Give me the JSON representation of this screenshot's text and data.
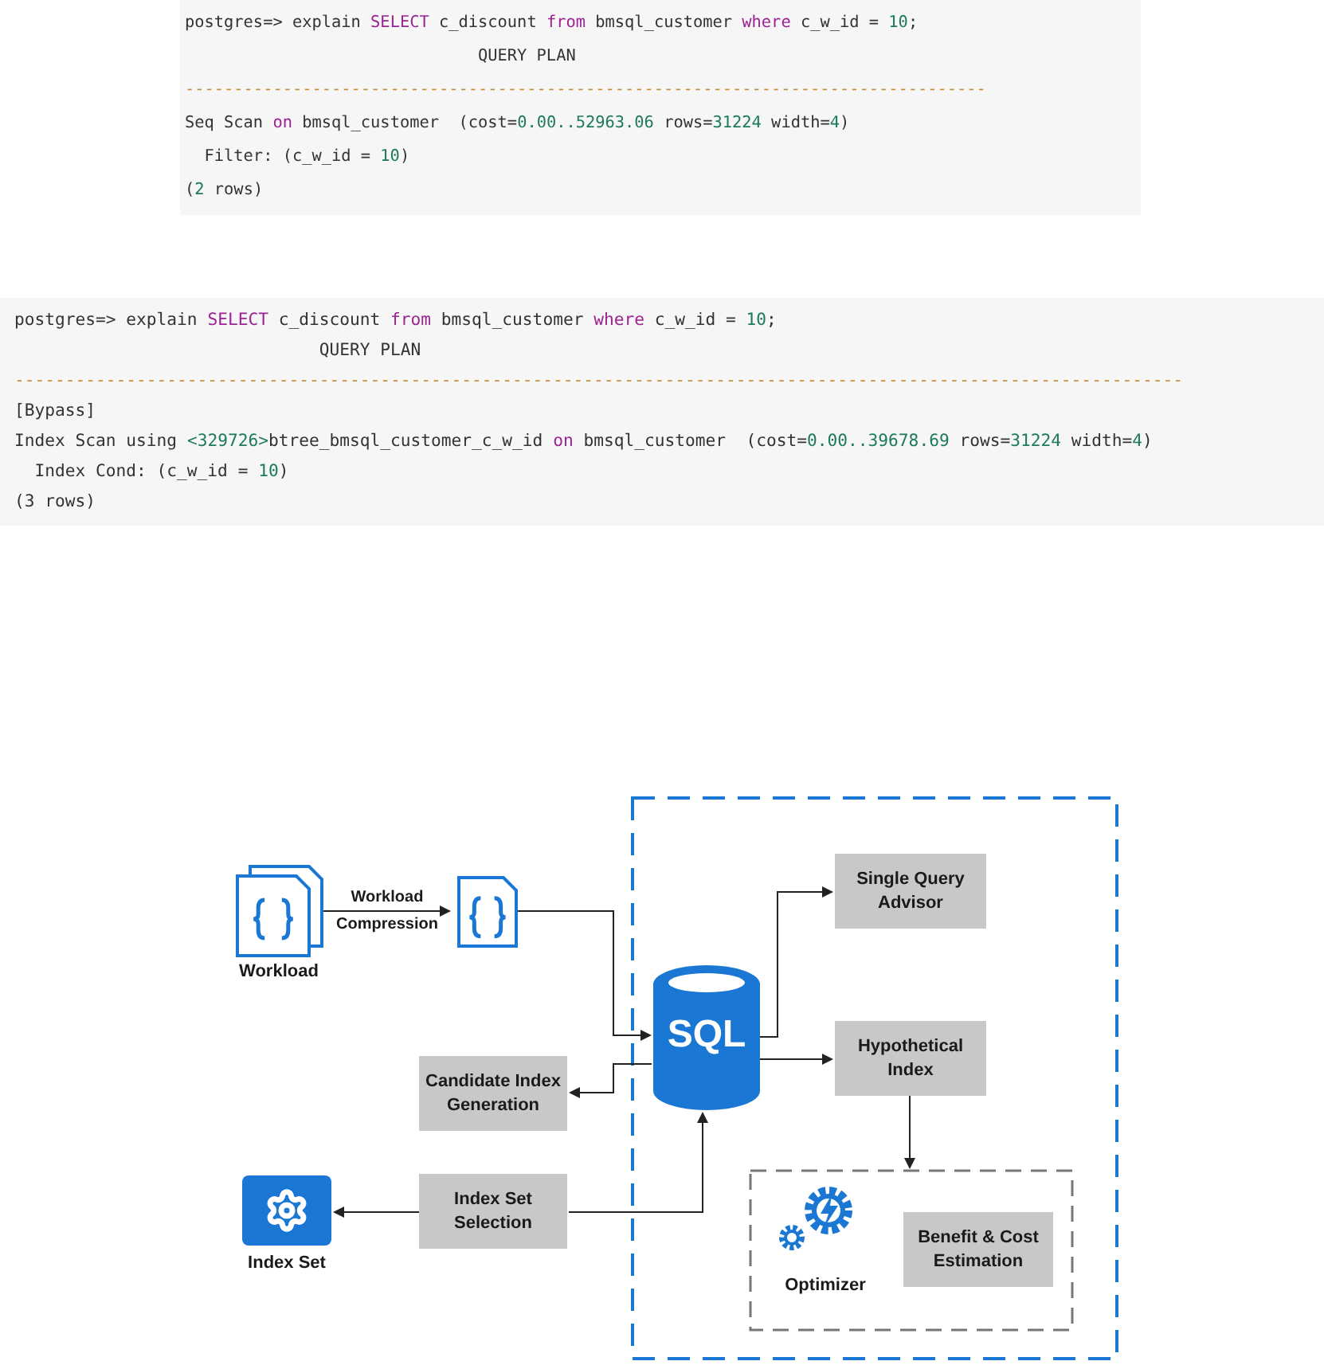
{
  "code_blocks": [
    {
      "lines": [
        [
          {
            "kind": "plain",
            "text": "postgres=> explain "
          },
          {
            "kind": "keyword",
            "text": "SELECT"
          },
          {
            "kind": "plain",
            "text": " c_discount "
          },
          {
            "kind": "keyword",
            "text": "from"
          },
          {
            "kind": "plain",
            "text": " bmsql_customer "
          },
          {
            "kind": "keyword",
            "text": "where"
          },
          {
            "kind": "plain",
            "text": " c_w_id = "
          },
          {
            "kind": "number",
            "text": "10"
          },
          {
            "kind": "plain",
            "text": ";"
          }
        ],
        [
          {
            "kind": "plain",
            "text": "                              QUERY PLAN"
          }
        ],
        [
          {
            "kind": "rule",
            "text": "----------------------------------------------------------------------------------"
          }
        ],
        [
          {
            "kind": "plain",
            "text": "Seq Scan "
          },
          {
            "kind": "keyword",
            "text": "on"
          },
          {
            "kind": "plain",
            "text": " bmsql_customer  (cost="
          },
          {
            "kind": "number",
            "text": "0.00..52963.06"
          },
          {
            "kind": "plain",
            "text": " rows="
          },
          {
            "kind": "number",
            "text": "31224"
          },
          {
            "kind": "plain",
            "text": " width="
          },
          {
            "kind": "number",
            "text": "4"
          },
          {
            "kind": "plain",
            "text": ")"
          }
        ],
        [
          {
            "kind": "plain",
            "text": "  Filter: (c_w_id = "
          },
          {
            "kind": "number",
            "text": "10"
          },
          {
            "kind": "plain",
            "text": ")"
          }
        ],
        [
          {
            "kind": "plain",
            "text": "("
          },
          {
            "kind": "number",
            "text": "2"
          },
          {
            "kind": "plain",
            "text": " rows)"
          }
        ]
      ]
    },
    {
      "lines": [
        [
          {
            "kind": "plain",
            "text": "postgres=> explain "
          },
          {
            "kind": "keyword",
            "text": "SELECT"
          },
          {
            "kind": "plain",
            "text": " c_discount "
          },
          {
            "kind": "keyword",
            "text": "from"
          },
          {
            "kind": "plain",
            "text": " bmsql_customer "
          },
          {
            "kind": "keyword",
            "text": "where"
          },
          {
            "kind": "plain",
            "text": " c_w_id = "
          },
          {
            "kind": "number",
            "text": "10"
          },
          {
            "kind": "plain",
            "text": ";"
          }
        ],
        [
          {
            "kind": "plain",
            "text": "                              QUERY PLAN"
          }
        ],
        [
          {
            "kind": "rule",
            "text": "-------------------------------------------------------------------------------------------------------------------"
          }
        ],
        [
          {
            "kind": "plain",
            "text": "[Bypass]"
          }
        ],
        [
          {
            "kind": "plain",
            "text": "Index Scan using "
          },
          {
            "kind": "number",
            "text": "<329726>"
          },
          {
            "kind": "plain",
            "text": "btree_bmsql_customer_c_w_id "
          },
          {
            "kind": "keyword",
            "text": "on"
          },
          {
            "kind": "plain",
            "text": " bmsql_customer  (cost="
          },
          {
            "kind": "number",
            "text": "0.00..39678.69"
          },
          {
            "kind": "plain",
            "text": " rows="
          },
          {
            "kind": "number",
            "text": "31224"
          },
          {
            "kind": "plain",
            "text": " width="
          },
          {
            "kind": "number",
            "text": "4"
          },
          {
            "kind": "plain",
            "text": ")"
          }
        ],
        [
          {
            "kind": "plain",
            "text": "  Index Cond: (c_w_id = "
          },
          {
            "kind": "number",
            "text": "10"
          },
          {
            "kind": "plain",
            "text": ")"
          }
        ],
        [
          {
            "kind": "plain",
            "text": "(3 rows)"
          }
        ]
      ]
    }
  ],
  "diagram": {
    "workload_label": "Workload",
    "compression_label": [
      "Workload",
      "Compression"
    ],
    "database_label": "SQL",
    "boxes": [
      {
        "kind": "single_query",
        "lines": [
          "Single Query",
          "Advisor"
        ]
      },
      {
        "kind": "hypothetical",
        "lines": [
          "Hypothetical",
          "Index"
        ]
      },
      {
        "kind": "candidate",
        "lines": [
          "Candidate Index",
          "Generation"
        ]
      },
      {
        "kind": "selection",
        "lines": [
          "Index Set",
          "Selection"
        ]
      },
      {
        "kind": "estimation",
        "lines": [
          "Benefit & Cost",
          "Estimation"
        ]
      }
    ],
    "optimizer_label": "Optimizer",
    "index_set_label": "Index Set"
  }
}
